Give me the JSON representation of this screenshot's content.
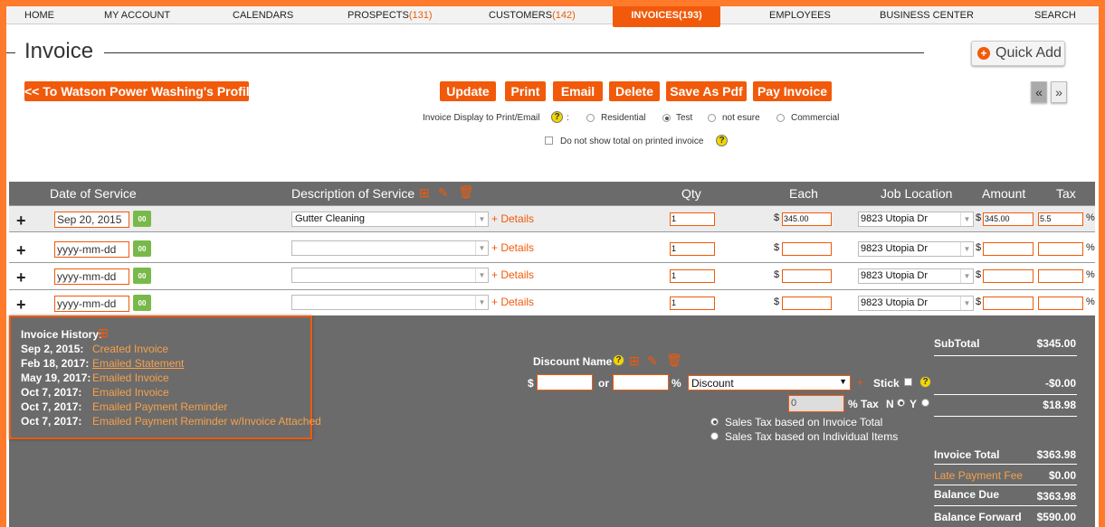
{
  "nav": {
    "home": "HOME",
    "my_account": "MY ACCOUNT",
    "calendars": "CALENDARS",
    "prospects": "PROSPECTS",
    "prospects_count": "(131)",
    "customers": "CUSTOMERS",
    "customers_count": "(142)",
    "invoices": "INVOICES(193)",
    "employees": "EMPLOYEES",
    "business_center": "BUSINESS CENTER",
    "search": "SEARCH"
  },
  "header": {
    "title": "Invoice",
    "quick_add": "Quick Add",
    "back_profile": "<< To Watson Power Washing's Profile",
    "prev_arrow": "«",
    "next_arrow": "»"
  },
  "actions": {
    "update": "Update",
    "print": "Print",
    "email": "Email",
    "delete": "Delete",
    "save_pdf": "Save As Pdf",
    "pay_invoice": "Pay Invoice"
  },
  "display_options": {
    "label": "Invoice Display to Print/Email",
    "colon": ":",
    "options": [
      "Residential",
      "Test",
      "not esure",
      "Commercial"
    ],
    "selected": "Test",
    "hide_total_label": "Do not show total on printed invoice"
  },
  "table": {
    "headers": {
      "date": "Date of Service",
      "description": "Description of Service",
      "qty": "Qty",
      "each": "Each",
      "location": "Job Location",
      "amount": "Amount",
      "tax": "Tax"
    },
    "details_label": "+ Details",
    "currency": "$",
    "percent": "%",
    "calendar_glyph": "00",
    "rows": [
      {
        "date": "Sep 20, 2015",
        "description": "Gutter Cleaning",
        "qty": "1",
        "each": "345.00",
        "location": "9823 Utopia Dr",
        "amount": "345.00",
        "tax": "5.5"
      },
      {
        "date": "yyyy-mm-dd",
        "description": "",
        "qty": "1",
        "each": "",
        "location": "9823 Utopia Dr",
        "amount": "",
        "tax": ""
      },
      {
        "date": "yyyy-mm-dd",
        "description": "",
        "qty": "1",
        "each": "",
        "location": "9823 Utopia Dr",
        "amount": "",
        "tax": ""
      },
      {
        "date": "yyyy-mm-dd",
        "description": "",
        "qty": "1",
        "each": "",
        "location": "9823 Utopia Dr",
        "amount": "",
        "tax": ""
      }
    ]
  },
  "history": {
    "title": "Invoice History:",
    "entries": [
      {
        "date": "Sep 2, 2015:",
        "event": "Created Invoice"
      },
      {
        "date": "Feb 18, 2017:",
        "event": "Emailed Statement"
      },
      {
        "date": "May 19, 2017:",
        "event": "Emailed Invoice"
      },
      {
        "date": "Oct 7, 2017:",
        "event": "Emailed Invoice"
      },
      {
        "date": "Oct 7, 2017:",
        "event": "Emailed Payment Reminder"
      },
      {
        "date": "Oct 7, 2017:",
        "event": "Emailed Payment Reminder w/Invoice Attached"
      }
    ]
  },
  "discount": {
    "name_label": "Discount Name",
    "currency": "$",
    "or": "or",
    "percent": "%",
    "select_value": "Discount",
    "plus": "+",
    "stick_label": "Stick",
    "tax_value": "0",
    "tax_label": "% Tax",
    "tax_n": "N",
    "tax_y": "Y",
    "sales_tax_total": "Sales Tax based on Invoice Total",
    "sales_tax_items": "Sales Tax based on Individual Items"
  },
  "summary": {
    "subtotal_label": "SubTotal",
    "subtotal_value": "$345.00",
    "discount_value": "-$0.00",
    "tax_value": "$18.98",
    "invoice_total_label": "Invoice Total",
    "invoice_total_value": "$363.98",
    "late_fee_label": "Late Payment Fee",
    "late_fee_value": "$0.00",
    "balance_due_label": "Balance Due",
    "balance_due_value": "$363.98",
    "balance_forward_label": "Balance Forward",
    "balance_forward_value": "$590.00"
  }
}
